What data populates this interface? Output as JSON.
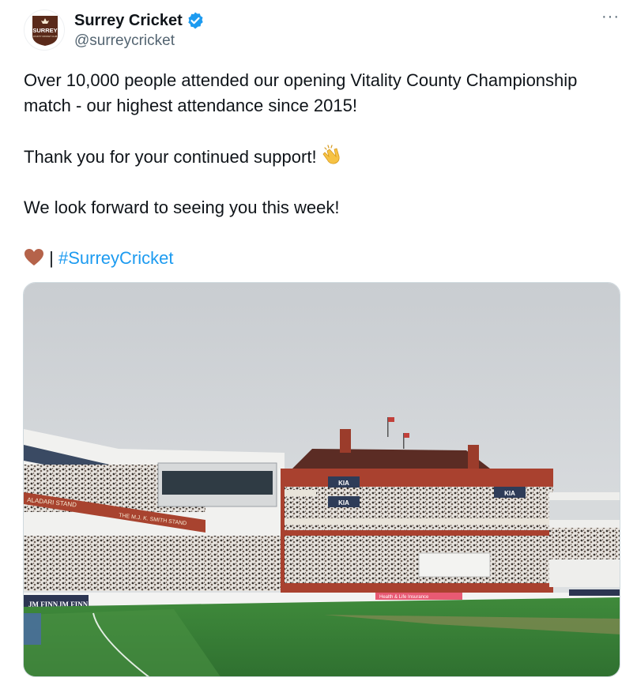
{
  "account": {
    "display_name": "Surrey Cricket",
    "handle": "@surreycricket",
    "verified_icon": "verified-badge-icon",
    "avatar_text": "SURREY",
    "avatar_subtext": "COUNTY CRICKET CLUB",
    "brand_color": "#5a2a1a"
  },
  "more_menu": {
    "label": "···"
  },
  "tweet": {
    "line1": "Over 10,000 people attended our opening Vitality County Championship match - our highest attendance since 2015!",
    "line2": "Thank you for your continued support!",
    "line3": "We look forward to seeing you this week!",
    "separator": "|",
    "hashtag": "#SurreyCricket",
    "hashtag_color": "#1d9bf0",
    "heart_emoji": "brown-heart-icon",
    "clap_emoji": "clapping-hands-icon"
  },
  "media": {
    "stand_label_1": "ALADARI STAND",
    "stand_label_2": "THE M.J. K. SMITH STAND",
    "boundary_board": "JM FINN",
    "sponsor_mark": "KIA",
    "sponsor_text": "Health & Life Insurance"
  }
}
